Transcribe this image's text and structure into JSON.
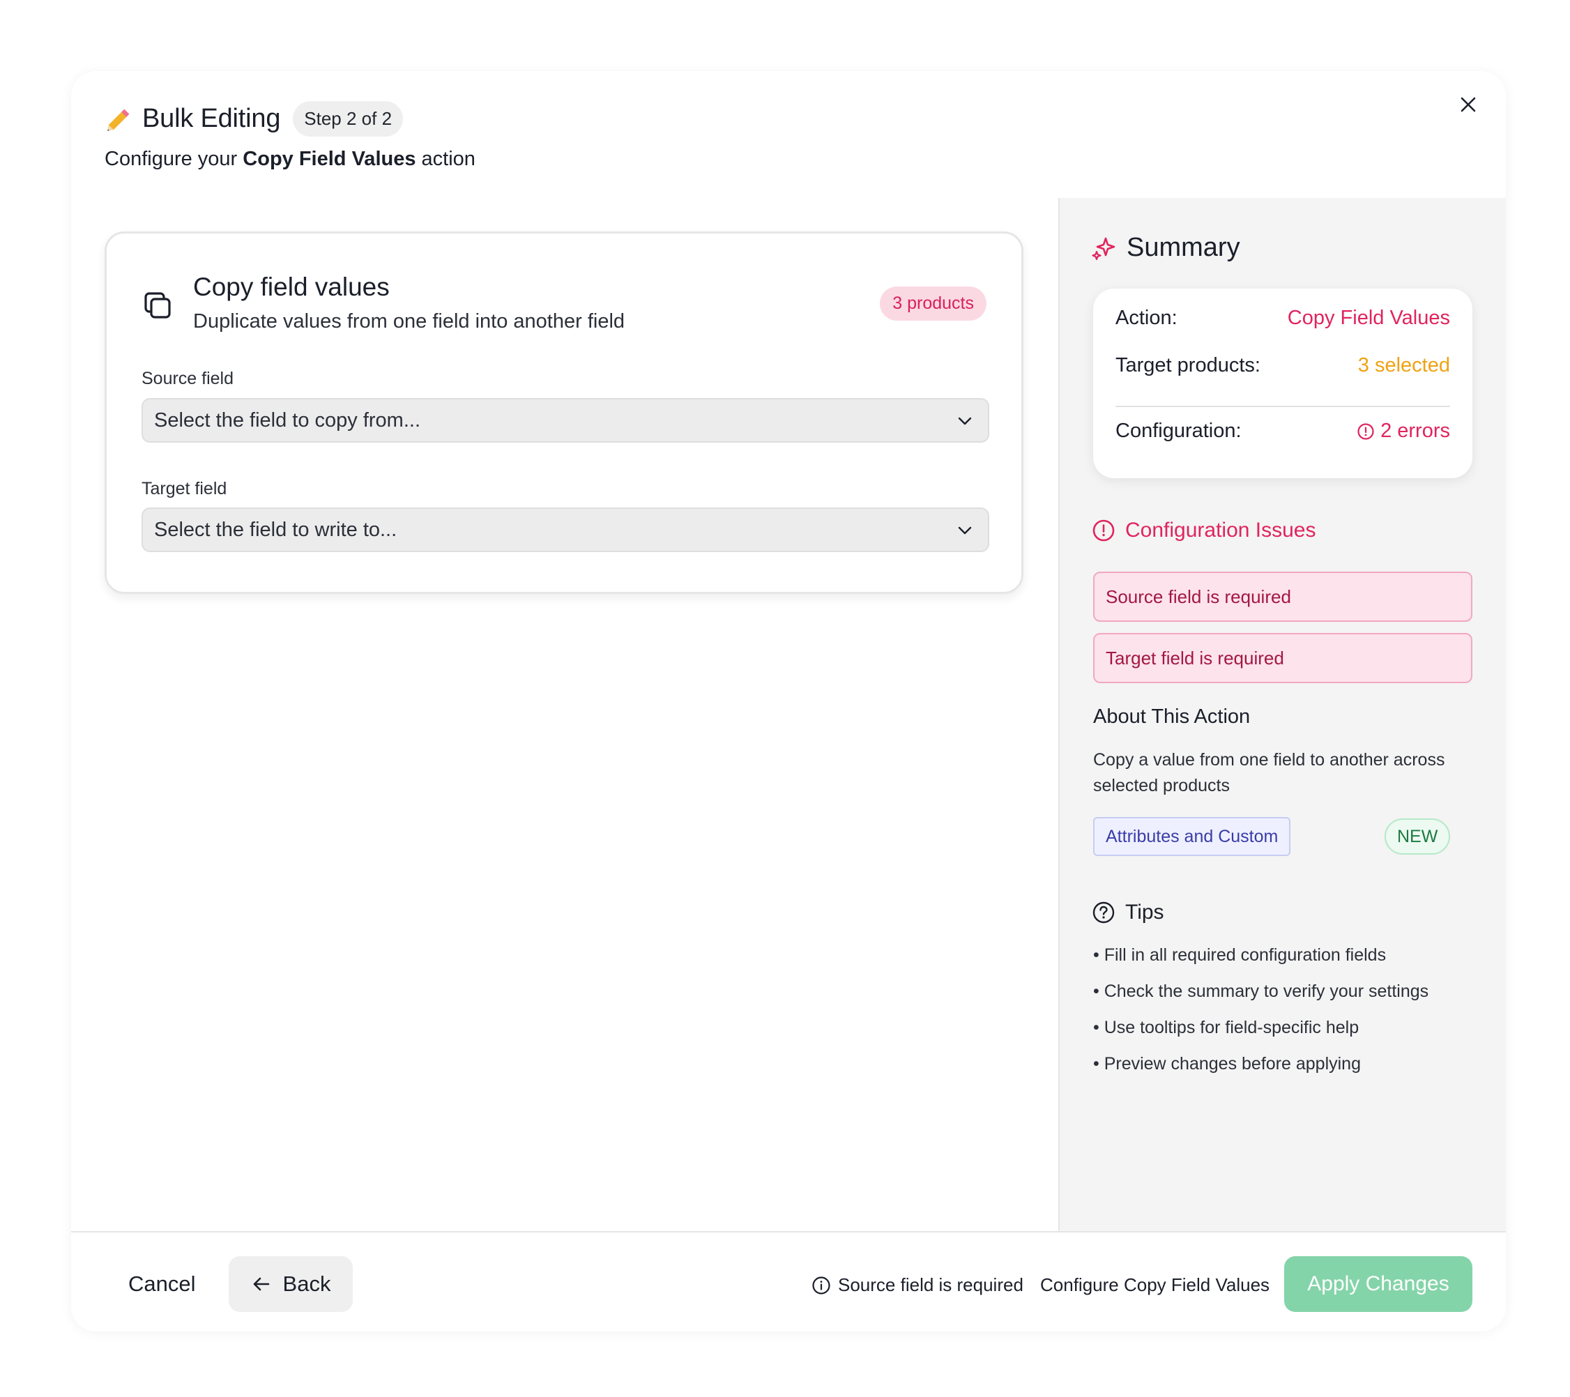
{
  "header": {
    "title": "Bulk Editing",
    "step": "Step 2 of 2",
    "subtitle_prefix": "Configure your",
    "subtitle_action": "Copy Field Values",
    "subtitle_suffix": "action"
  },
  "card": {
    "title": "Copy field values",
    "description": "Duplicate values from one field into another field",
    "badge": "3 products",
    "source": {
      "label": "Source field",
      "placeholder": "Select the field to copy from..."
    },
    "target": {
      "label": "Target field",
      "placeholder": "Select the field to write to..."
    }
  },
  "summary": {
    "title": "Summary",
    "action_key": "Action:",
    "action_val": "Copy Field Values",
    "targets_key": "Target products:",
    "targets_val": "3 selected",
    "config_key": "Configuration:",
    "config_val": "2 errors"
  },
  "issues": {
    "title": "Configuration Issues",
    "items": [
      "Source field is required",
      "Target field is required"
    ]
  },
  "about": {
    "title": "About This Action",
    "text": "Copy a value from one field to another across selected products",
    "tag_category": "Attributes and Custom",
    "tag_new": "NEW"
  },
  "tips": {
    "title": "Tips",
    "items": [
      "• Fill in all required configuration fields",
      "• Check the summary to verify your settings",
      "• Use tooltips for field-specific help",
      "• Preview changes before applying"
    ]
  },
  "footer": {
    "cancel": "Cancel",
    "back": "Back",
    "message": "Source field is required",
    "config": "Configure Copy Field Values",
    "apply": "Apply Changes"
  },
  "colors": {
    "accent_pink": "#e0245e",
    "accent_orange": "#f0a213",
    "apply_green": "#84d4a9"
  },
  "icons": [
    "pencil-icon",
    "close-icon",
    "copy-icon",
    "chevron-down-icon",
    "sparkle-icon",
    "alert-circle-icon",
    "help-circle-icon",
    "arrow-left-icon",
    "info-icon"
  ]
}
